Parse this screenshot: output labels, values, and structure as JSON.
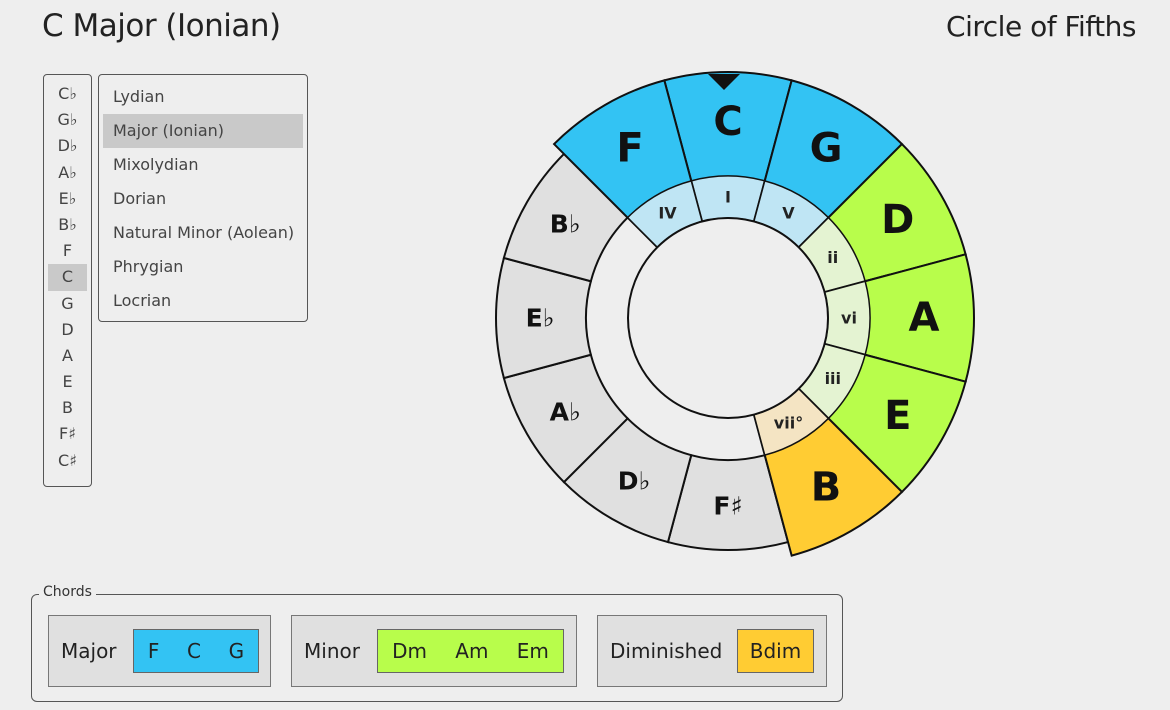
{
  "header": {
    "title": "C Major (Ionian)",
    "app_title": "Circle of Fifths"
  },
  "keys": {
    "items": [
      "C♭",
      "G♭",
      "D♭",
      "A♭",
      "E♭",
      "B♭",
      "F",
      "C",
      "G",
      "D",
      "A",
      "E",
      "B",
      "F♯",
      "C♯"
    ],
    "selected": "C"
  },
  "modes": {
    "items": [
      "Lydian",
      "Major (Ionian)",
      "Mixolydian",
      "Dorian",
      "Natural Minor (Aolean)",
      "Phrygian",
      "Locrian"
    ],
    "selected": "Major (Ionian)"
  },
  "wheel": {
    "pointer_icon": "triangle-down-icon",
    "outer": [
      {
        "note": "C",
        "color": "#33c3f3",
        "active": true
      },
      {
        "note": "G",
        "color": "#33c3f3",
        "active": true
      },
      {
        "note": "D",
        "color": "#b8fd4b",
        "active": true
      },
      {
        "note": "A",
        "color": "#b8fd4b",
        "active": true
      },
      {
        "note": "E",
        "color": "#b8fd4b",
        "active": true
      },
      {
        "note": "B",
        "color": "#ffcc33",
        "active": true
      },
      {
        "note": "F♯",
        "color": "#e0e0e0",
        "active": false
      },
      {
        "note": "D♭",
        "color": "#e0e0e0",
        "active": false
      },
      {
        "note": "A♭",
        "color": "#e0e0e0",
        "active": false
      },
      {
        "note": "E♭",
        "color": "#e0e0e0",
        "active": false
      },
      {
        "note": "B♭",
        "color": "#e0e0e0",
        "active": false
      },
      {
        "note": "F",
        "color": "#33c3f3",
        "active": true
      }
    ],
    "inner": [
      {
        "degree": "I",
        "color": "#bfe5f4"
      },
      {
        "degree": "V",
        "color": "#bfe5f4"
      },
      {
        "degree": "ii",
        "color": "#e4f3d2"
      },
      {
        "degree": "vi",
        "color": "#e4f3d2"
      },
      {
        "degree": "iii",
        "color": "#e4f3d2"
      },
      {
        "degree": "vii°",
        "color": "#f4e4c3"
      },
      {
        "degree": "",
        "color": null
      },
      {
        "degree": "",
        "color": null
      },
      {
        "degree": "",
        "color": null
      },
      {
        "degree": "",
        "color": null
      },
      {
        "degree": "",
        "color": null
      },
      {
        "degree": "IV",
        "color": "#bfe5f4"
      }
    ]
  },
  "chords": {
    "legend": "Chords",
    "major": {
      "label": "Major",
      "items": [
        "F",
        "C",
        "G"
      ],
      "color": "#33c3f3"
    },
    "minor": {
      "label": "Minor",
      "items": [
        "Dm",
        "Am",
        "Em"
      ],
      "color": "#b8fd4b"
    },
    "diminished": {
      "label": "Diminished",
      "items": [
        "Bdim"
      ],
      "color": "#ffcc33"
    }
  }
}
